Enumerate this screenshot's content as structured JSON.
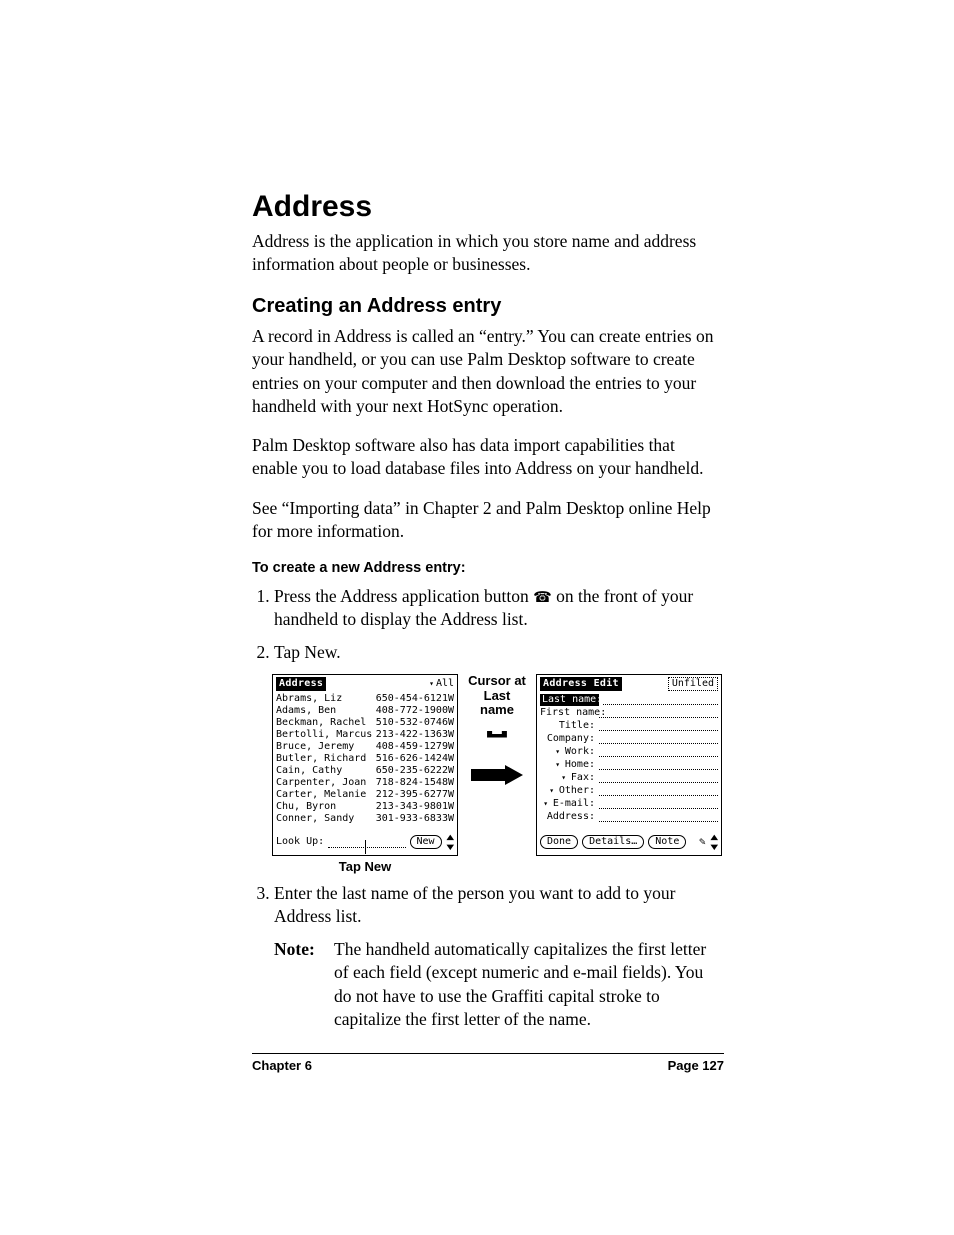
{
  "h1": "Address",
  "intro": "Address is the application in which you store name and address information about people or businesses.",
  "h2": "Creating an Address entry",
  "p1": "A record in Address is called an “entry.” You can create entries on your handheld, or you can use Palm Desktop software to create entries on your computer and then download the entries to your handheld with your next HotSync operation.",
  "p2": "Palm Desktop software also has data import capabilities that enable you to load database files into Address on your handheld.",
  "p3": "See “Importing data” in Chapter 2 and Palm Desktop online Help for more information.",
  "h3": "To create a new Address entry:",
  "step1_a": "Press the Address application button ",
  "step1_icon": "☎",
  "step1_b": " on the front of your handheld to display the Address list.",
  "step2": "Tap New.",
  "step3": "Enter the last name of the person you want to add to your Address list.",
  "note_label": "Note:",
  "note_body": "The handheld automatically capitalizes the first letter of each field (except numeric and e-mail fields). You do not have to use the Graffiti capital stroke to capitalize the first letter of the name.",
  "footer_left": "Chapter 6",
  "footer_right": "Page 127",
  "callout_cursor": "Cursor at Last name",
  "callout_tapnew": "Tap New",
  "screen_left": {
    "title": "Address",
    "category": "All",
    "lookup_label": "Look Up:",
    "new_btn": "New",
    "rows": [
      {
        "n": "Abrams, Liz",
        "p": "650-454-6121W"
      },
      {
        "n": "Adams, Ben",
        "p": "408-772-1900W"
      },
      {
        "n": "Beckman, Rachel",
        "p": "510-532-0746W"
      },
      {
        "n": "Bertolli, Marcus",
        "p": "213-422-1363W"
      },
      {
        "n": "Bruce, Jeremy",
        "p": "408-459-1279W"
      },
      {
        "n": "Butler, Richard",
        "p": "516-626-1424W"
      },
      {
        "n": "Cain, Cathy",
        "p": "650-235-6222W"
      },
      {
        "n": "Carpenter, Joan",
        "p": "718-824-1548W"
      },
      {
        "n": "Carter, Melanie",
        "p": "212-395-6277W"
      },
      {
        "n": "Chu, Byron",
        "p": "213-343-9801W"
      },
      {
        "n": "Conner, Sandy",
        "p": "301-933-6833W"
      }
    ]
  },
  "screen_right": {
    "title": "Address Edit",
    "category": "Unfiled",
    "fields": [
      {
        "label": "Last name:",
        "sel": true,
        "dd": false
      },
      {
        "label": "First name:",
        "sel": false,
        "dd": false
      },
      {
        "label": "Title:",
        "sel": false,
        "dd": false
      },
      {
        "label": "Company:",
        "sel": false,
        "dd": false
      },
      {
        "label": "Work:",
        "sel": false,
        "dd": true
      },
      {
        "label": "Home:",
        "sel": false,
        "dd": true
      },
      {
        "label": "Fax:",
        "sel": false,
        "dd": true
      },
      {
        "label": "Other:",
        "sel": false,
        "dd": true
      },
      {
        "label": "E-mail:",
        "sel": false,
        "dd": true
      },
      {
        "label": "Address:",
        "sel": false,
        "dd": false
      }
    ],
    "done": "Done",
    "details": "Details…",
    "note": "Note"
  }
}
